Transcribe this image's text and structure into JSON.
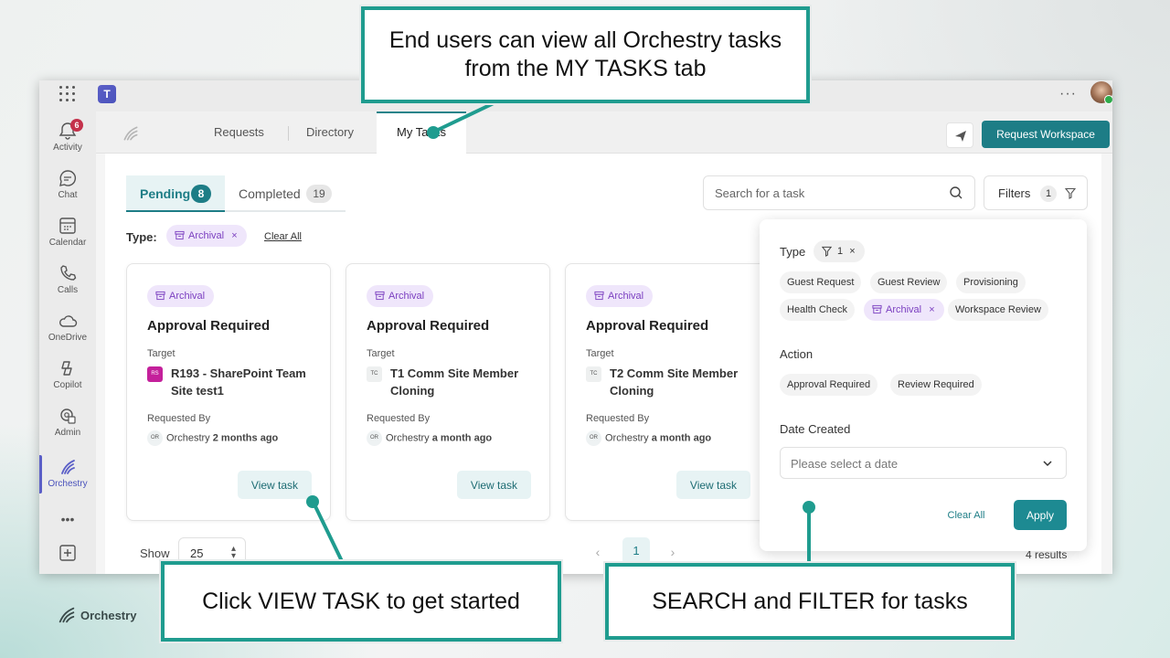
{
  "callouts": {
    "top_line1": "End users can view all Orchestry tasks",
    "top_line2": "from the MY TASKS tab",
    "bottom_left": "Click VIEW TASK to get started",
    "bottom_right": "SEARCH and FILTER for tasks"
  },
  "brand": {
    "name": "Orchestry",
    "accent": "#1d7d86",
    "callout_border": "#1f9c8f"
  },
  "topbar": {
    "teams_glyph": "T",
    "more": "···"
  },
  "rail": {
    "activity_badge": "6",
    "items": [
      {
        "label": "Activity",
        "icon": "bell-icon"
      },
      {
        "label": "Chat",
        "icon": "chat-icon"
      },
      {
        "label": "Calendar",
        "icon": "calendar-icon"
      },
      {
        "label": "Calls",
        "icon": "phone-icon"
      },
      {
        "label": "OneDrive",
        "icon": "cloud-icon"
      },
      {
        "label": "Copilot",
        "icon": "copilot-icon"
      },
      {
        "label": "Admin",
        "icon": "admin-icon"
      },
      {
        "label": "Orchestry",
        "icon": "orchestry-icon"
      }
    ],
    "more": "•••"
  },
  "app_tabs": [
    "Requests",
    "Directory",
    "My Tasks"
  ],
  "request_workspace": "Request Workspace",
  "status_tabs": {
    "pending_label": "Pending",
    "pending_count": "8",
    "completed_label": "Completed",
    "completed_count": "19"
  },
  "type_filter": {
    "label": "Type:",
    "chip": "Archival",
    "remove": "×",
    "clear_all": "Clear All"
  },
  "search": {
    "placeholder": "Search for a task"
  },
  "filters": {
    "label": "Filters",
    "count": "1"
  },
  "cards": [
    {
      "type": "Archival",
      "title": "Approval Required",
      "target_label": "Target",
      "target_initials": "RS",
      "target_name": "R193 - SharePoint Team Site test1",
      "requested_by_label": "Requested By",
      "requester_initials": "OR",
      "requester": "Orchestry",
      "ago": "2 months ago",
      "button": "View task"
    },
    {
      "type": "Archival",
      "title": "Approval Required",
      "target_label": "Target",
      "target_initials": "TC",
      "target_name": "T1 Comm Site Member Cloning",
      "requested_by_label": "Requested By",
      "requester_initials": "OR",
      "requester": "Orchestry",
      "ago": "a month ago",
      "button": "View task"
    },
    {
      "type": "Archival",
      "title": "Approval Required",
      "target_label": "Target",
      "target_initials": "TC",
      "target_name": "T2 Comm Site Member Cloning",
      "requested_by_label": "Requested By",
      "requester_initials": "OR",
      "requester": "Orchestry",
      "ago": "a month ago",
      "button": "View task"
    }
  ],
  "pagination": {
    "show_label": "Show",
    "page_size": "25",
    "prev": "‹",
    "current": "1",
    "next": "›",
    "results": "4 results"
  },
  "filter_panel": {
    "type_label": "Type",
    "type_count": "1",
    "type_count_remove": "×",
    "type_options": [
      "Guest Request",
      "Guest Review",
      "Provisioning",
      "Health Check",
      "Archival",
      "Workspace Review"
    ],
    "selected_remove": "×",
    "action_label": "Action",
    "action_options": [
      "Approval Required",
      "Review Required"
    ],
    "date_label": "Date Created",
    "date_placeholder": "Please select a date",
    "clear_all": "Clear All",
    "apply": "Apply"
  }
}
